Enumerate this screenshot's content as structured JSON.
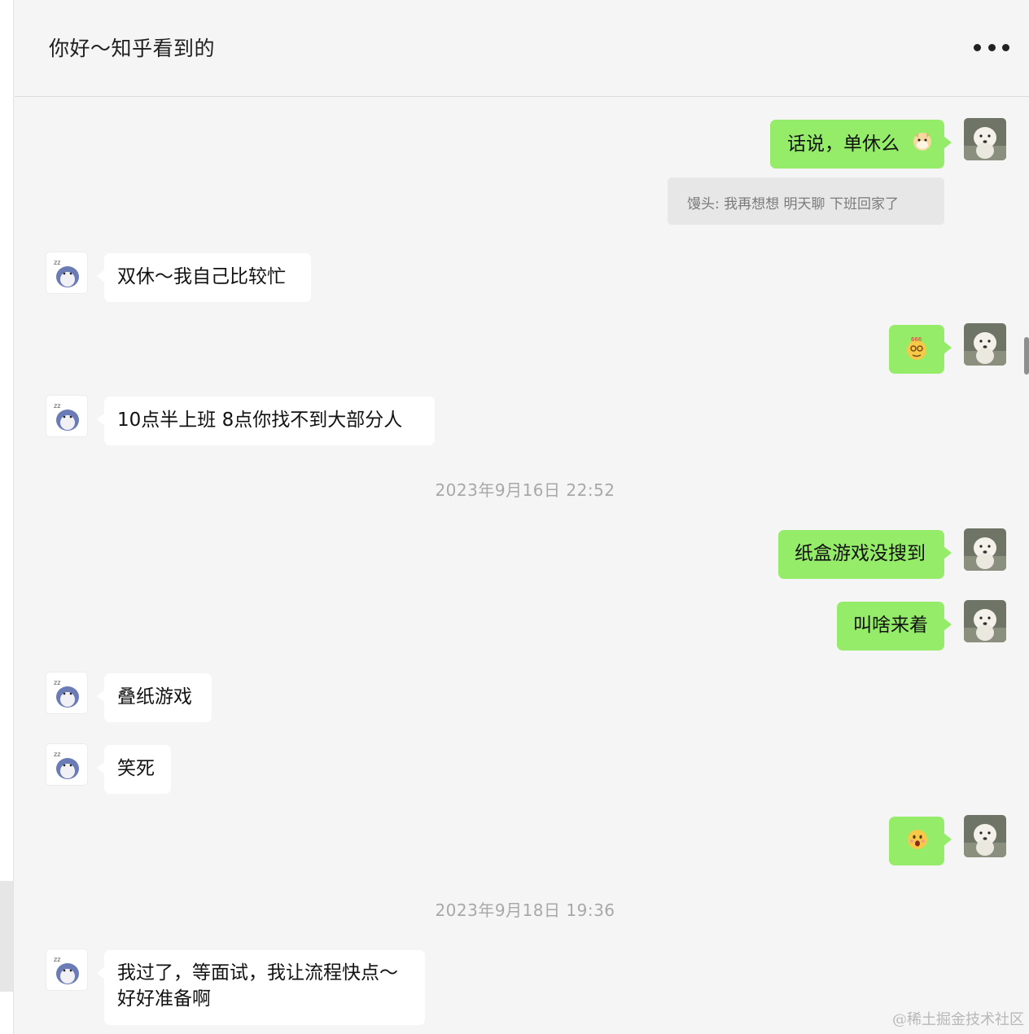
{
  "header": {
    "title": "你好～知乎看到的",
    "more_icon": "ellipsis-icon"
  },
  "messages": {
    "m1": "话说，单休么",
    "quote": "馒头: 我再想想  明天聊  下班回家了",
    "m2": "双休～我自己比较忙",
    "m4": "10点半上班 8点你找不到大部分人",
    "ts1": "2023年9月16日 22:52",
    "m5": "纸盒游戏没搜到",
    "m6": "叫啥来着",
    "m7": "叠纸游戏",
    "m8": "笑死",
    "ts2": "2023年9月18日 19:36",
    "m10_line1": "我过了，等面试，我让流程快点～",
    "m10_line2": "好好准备啊"
  },
  "emoji_labels": {
    "m1": "doge-emoji",
    "m3": "666-emoji",
    "m9": "surprised-emoji"
  },
  "watermark": "@稀土掘金技术社区",
  "colors": {
    "mine_bubble": "#95ec69",
    "theirs_bubble": "#ffffff",
    "background": "#f5f5f5"
  }
}
